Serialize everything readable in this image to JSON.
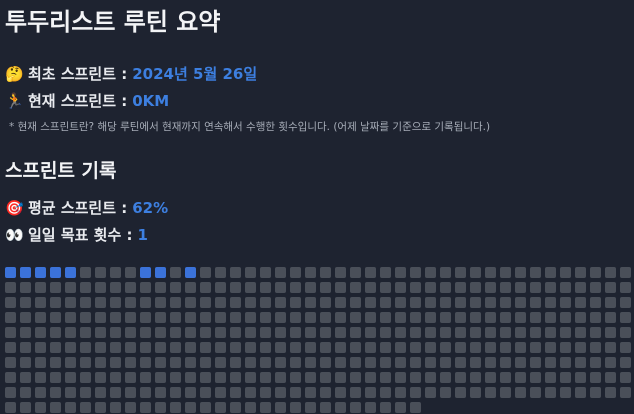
{
  "title": "투두리스트 루틴 요약",
  "first_sprint": {
    "icon": "thinking-face-icon",
    "emoji": "🤔",
    "label": "최초 스프린트 :",
    "value": "2024년 5월 26일"
  },
  "current_sprint": {
    "icon": "runner-icon",
    "emoji": "🏃",
    "label": "현재 스프린트 :",
    "value": "0KM"
  },
  "note": "* 현재 스프린트란? 해당 루틴에서 현재까지 연속해서 수행한 횟수입니다. (어제 날짜를 기준으로 기록됩니다.)",
  "record_section": {
    "title": "스프린트 기록"
  },
  "average_sprint": {
    "icon": "target-icon",
    "emoji": "🎯",
    "label": "평균 스프린트 :",
    "value": "62%"
  },
  "daily_goal": {
    "icon": "eyes-icon",
    "emoji": "👀",
    "label": "일일 목표 횟수 :",
    "value": "1"
  },
  "record_grid": {
    "columns": 42,
    "rows": 9,
    "total": 406,
    "completed_indices": [
      0,
      1,
      2,
      3,
      4,
      9,
      10,
      12
    ],
    "colors": {
      "completed": "#3b72d9",
      "empty": "#4a4f59"
    }
  }
}
